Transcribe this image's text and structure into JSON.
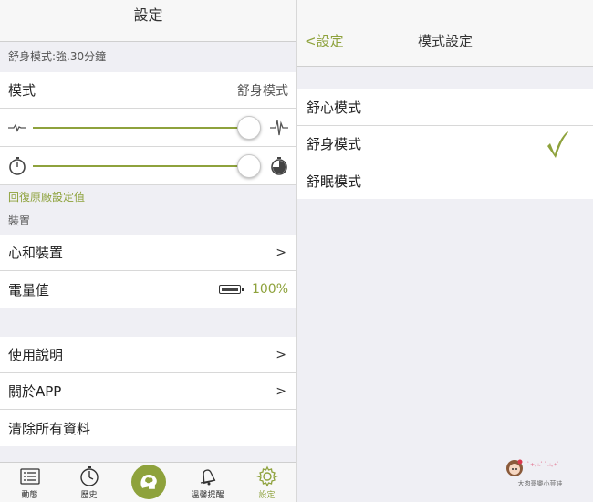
{
  "left": {
    "header_title": "設定",
    "mode_section_label": "舒身模式:強.30分鐘",
    "mode_row": {
      "label": "模式",
      "value": "舒身模式"
    },
    "intensity_slider": {
      "value": 1.0
    },
    "duration_slider": {
      "value": 1.0
    },
    "reset_link": "回復原廠設定值",
    "device_section_label": "裝置",
    "device_rows": [
      {
        "label": "心和裝置",
        "chevron": ">"
      },
      {
        "label": "電量值",
        "battery_percent": "100%"
      }
    ],
    "info_rows": [
      {
        "label": "使用說明",
        "chevron": ">"
      },
      {
        "label": "關於APP",
        "chevron": ">"
      },
      {
        "label": "清除所有資料"
      }
    ],
    "tabbar": [
      {
        "label": "動態",
        "icon": "list-icon"
      },
      {
        "label": "歷史",
        "icon": "stopwatch-icon"
      },
      {
        "label": "",
        "icon": "brain-icon"
      },
      {
        "label": "溫馨提醒",
        "icon": "bell-icon"
      },
      {
        "label": "設定",
        "icon": "gear-icon",
        "active": true
      }
    ],
    "accent_color": "#8ea23c"
  },
  "right": {
    "back_label": "<設定",
    "header_title": "模式設定",
    "modes": [
      {
        "label": "舒心模式",
        "selected": false
      },
      {
        "label": "舒身模式",
        "selected": true
      },
      {
        "label": "舒眠模式",
        "selected": false
      }
    ],
    "watermark_text": "大肉哥樂小荳娃",
    "watermark_sub": "ﾟ+｡:.ﾟ ﾟ.:｡+ﾟ"
  }
}
